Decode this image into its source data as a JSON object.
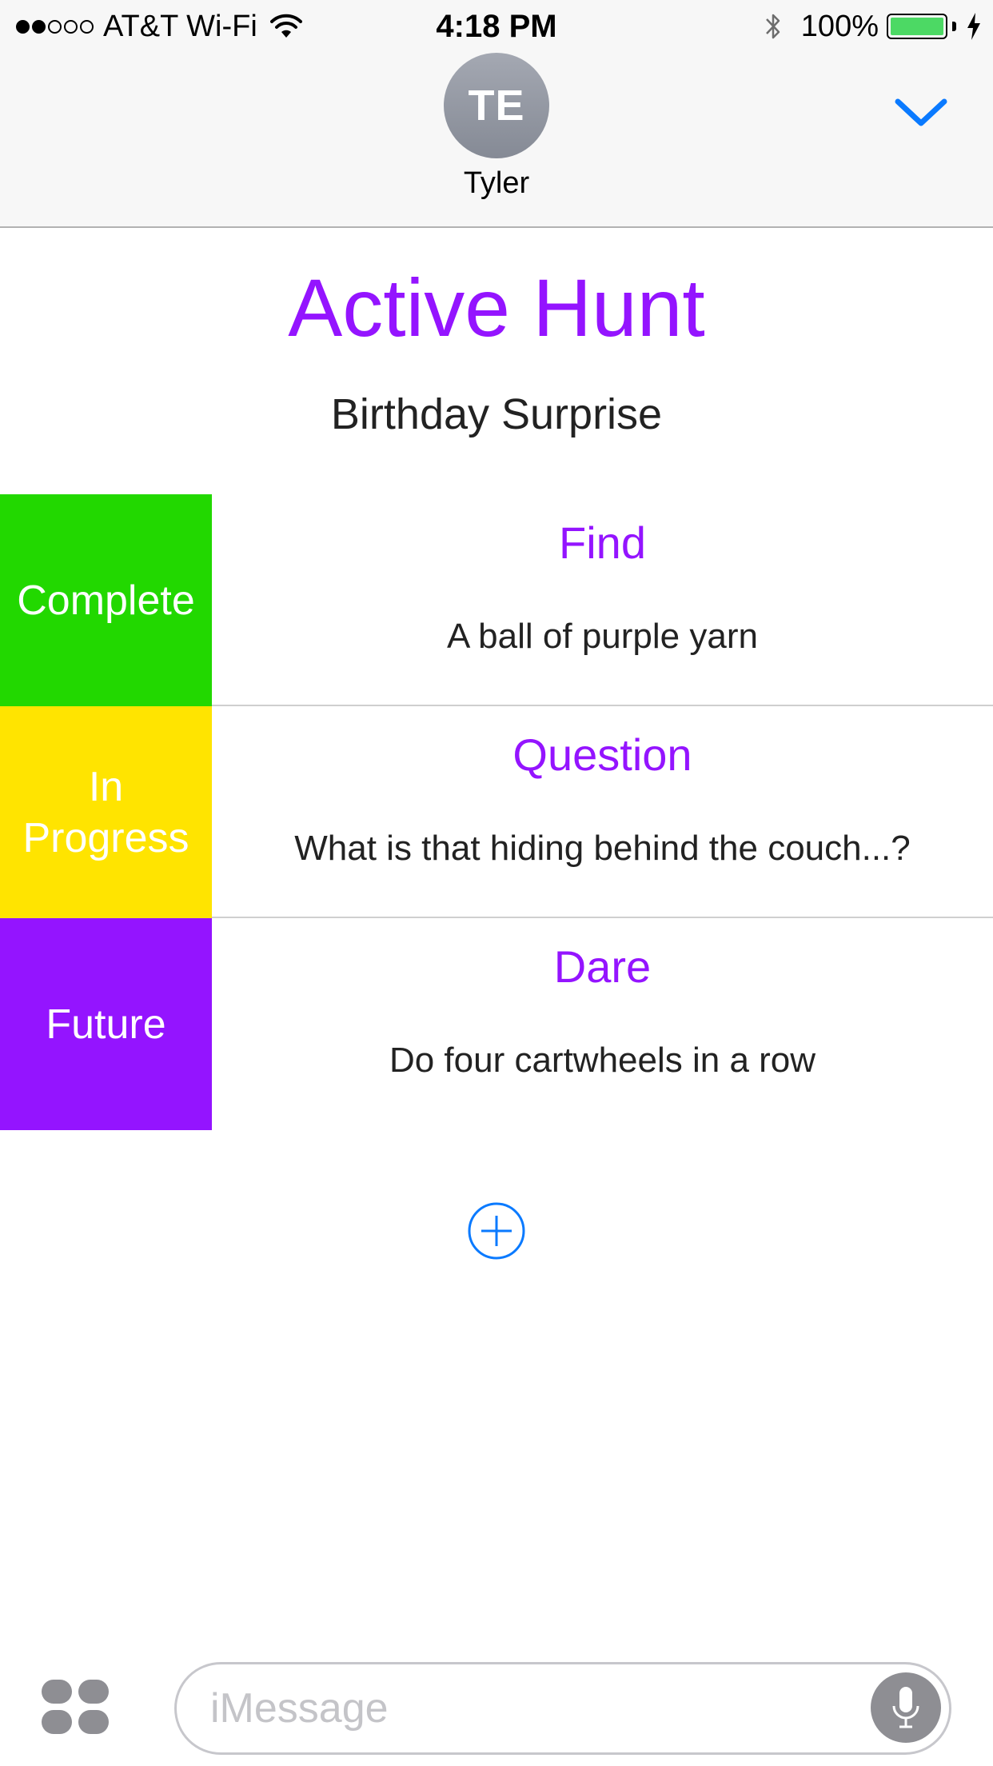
{
  "status_bar": {
    "carrier": "AT&T Wi-Fi",
    "time": "4:18 PM",
    "battery_percent": "100%",
    "battery_level": 1.0,
    "signal_bars_filled": 2,
    "signal_bars_total": 5
  },
  "header": {
    "avatar_initials": "TE",
    "contact_name": "Tyler",
    "collapse_icon": "chevron-down-icon"
  },
  "hunt": {
    "title": "Active Hunt",
    "name": "Birthday Surprise"
  },
  "tasks": [
    {
      "status": "Complete",
      "status_color": "#22d800",
      "type": "Find",
      "description": "A ball of purple yarn"
    },
    {
      "status": "In Progress",
      "status_color": "#ffe400",
      "type": "Question",
      "description": "What is that hiding behind the couch...?"
    },
    {
      "status": "Future",
      "status_color": "#9414ff",
      "type": "Dare",
      "description": "Do four cartwheels in a row"
    }
  ],
  "add_button_icon": "plus-circle-icon",
  "composer": {
    "placeholder": "iMessage",
    "apps_icon": "app-drawer-icon",
    "mic_icon": "microphone-icon"
  },
  "colors": {
    "accent_purple": "#9414ff",
    "ios_blue": "#0a7aff",
    "complete": "#22d800",
    "in_progress": "#ffe400",
    "future": "#9414ff"
  }
}
